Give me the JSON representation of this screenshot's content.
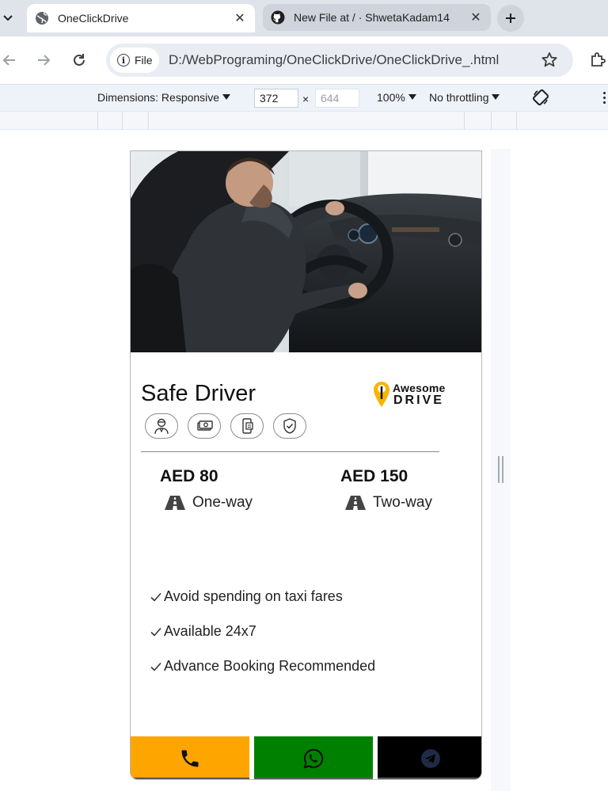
{
  "tabs": [
    {
      "title": "OneClickDrive",
      "icon": "globe-icon",
      "active": true
    },
    {
      "title": "New File at / · ShwetaKadam14",
      "icon": "github-icon",
      "active": false
    }
  ],
  "toolbar": {
    "scheme_chip": "File",
    "url": "D:/WebPrograming/OneClickDrive/OneClickDrive_.html"
  },
  "devtools": {
    "dimensions_label": "Dimensions: Responsive",
    "width": "372",
    "height": "644",
    "times": "×",
    "zoom": "100%",
    "throttling": "No throttling"
  },
  "card": {
    "title": "Safe Driver",
    "logo": {
      "word1": "Awesome",
      "word2": "DRIVE"
    },
    "feature_icons": [
      "driver-icon",
      "cash-icon",
      "mobile-booking-icon",
      "shield-check-icon"
    ],
    "prices": [
      {
        "amount": "AED 80",
        "type": "One-way"
      },
      {
        "amount": "AED 150",
        "type": "Two-way"
      }
    ],
    "benefits": [
      "Avoid spending on taxi fares",
      "Available 24x7",
      "Advance Booking Recommended"
    ],
    "actions": [
      {
        "name": "call",
        "icon": "phone-icon",
        "color": "#ffa500"
      },
      {
        "name": "whatsapp",
        "icon": "whatsapp-icon",
        "color": "#008000"
      },
      {
        "name": "telegram",
        "icon": "telegram-icon",
        "color": "#000000"
      }
    ]
  }
}
